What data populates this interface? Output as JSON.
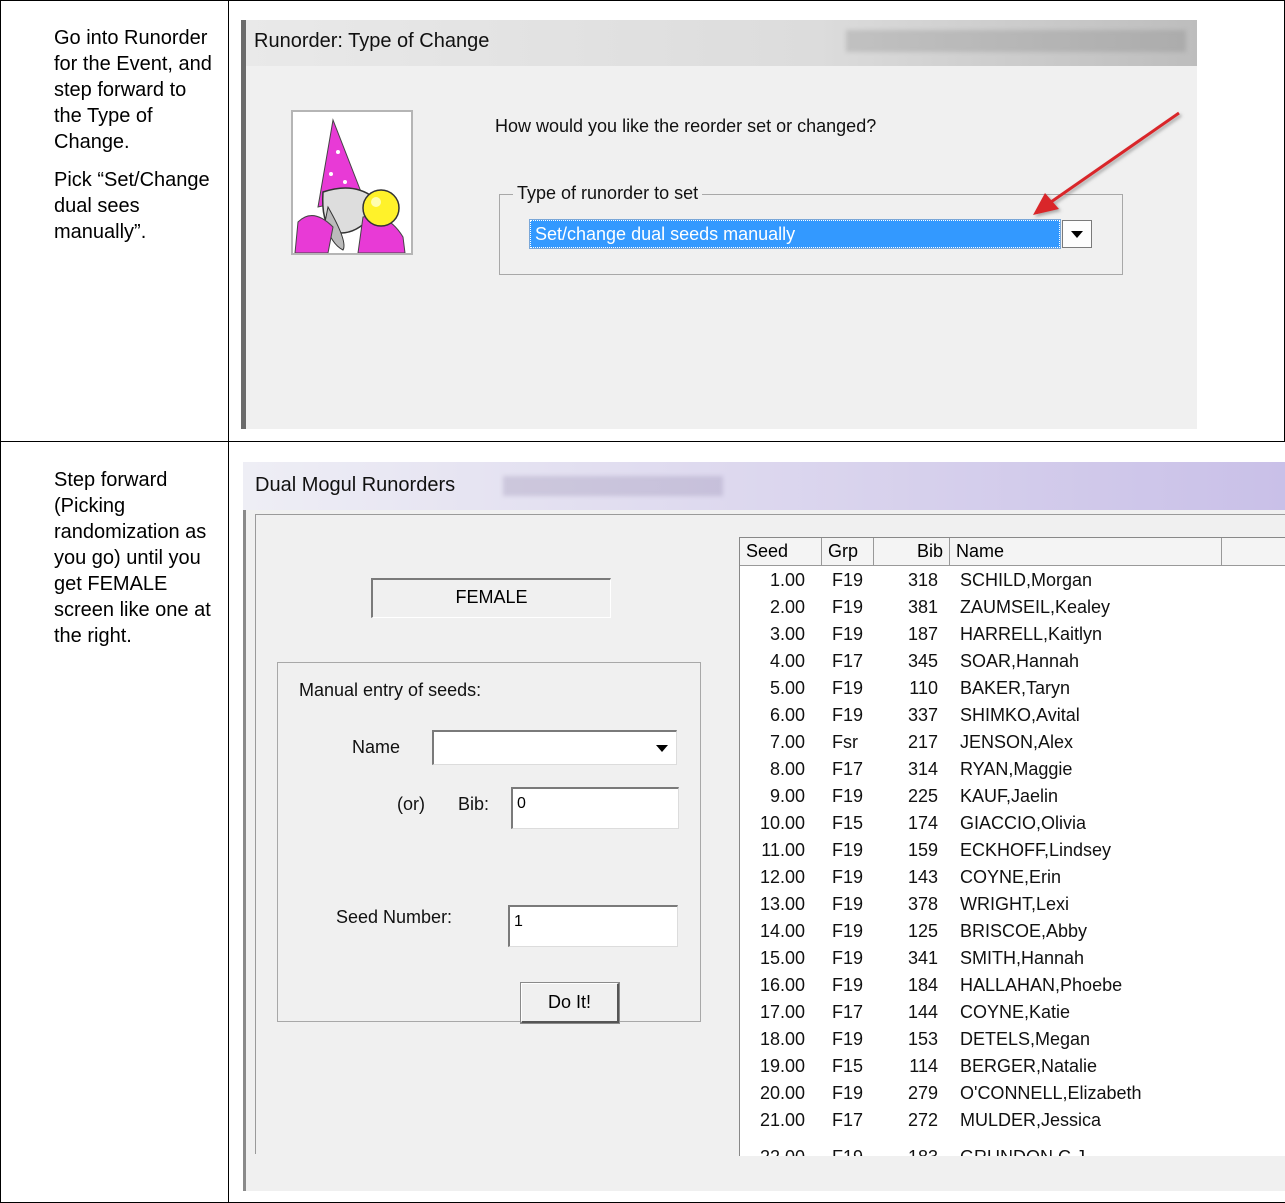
{
  "row1": {
    "instructions": [
      "Go into Runorder for the Event, and step forward to the Type of Change.",
      "Pick “Set/Change dual sees manually”."
    ],
    "screenshot": {
      "title": "Runorder: Type of Change",
      "question": "How would you like the reorder set or changed?",
      "group_label": "Type of runorder to set",
      "selected_option": "Set/change dual seeds manually",
      "annotation_arrow_color": "#d9262b"
    }
  },
  "row2": {
    "instructions": [
      "Step forward (Picking randomization as you go) until you get FEMALE screen like one at the right."
    ],
    "screenshot": {
      "title": "Dual Mogul Runorders",
      "gender_display": "FEMALE",
      "manual_group_label": "Manual entry of seeds:",
      "name_label": "Name",
      "name_value": "",
      "or_label": "(or)",
      "bib_label": "Bib:",
      "bib_value": "0",
      "seed_label": "Seed Number:",
      "seed_value": "1",
      "do_it_label": "Do It!",
      "columns": [
        "Seed",
        "Grp",
        "Bib",
        "Name"
      ],
      "rows": [
        {
          "seed": "1.00",
          "grp": "F19",
          "bib": "318",
          "name": "SCHILD,Morgan"
        },
        {
          "seed": "2.00",
          "grp": "F19",
          "bib": "381",
          "name": "ZAUMSEIL,Kealey"
        },
        {
          "seed": "3.00",
          "grp": "F19",
          "bib": "187",
          "name": "HARRELL,Kaitlyn"
        },
        {
          "seed": "4.00",
          "grp": "F17",
          "bib": "345",
          "name": "SOAR,Hannah"
        },
        {
          "seed": "5.00",
          "grp": "F19",
          "bib": "110",
          "name": "BAKER,Taryn"
        },
        {
          "seed": "6.00",
          "grp": "F19",
          "bib": "337",
          "name": "SHIMKO,Avital"
        },
        {
          "seed": "7.00",
          "grp": "Fsr",
          "bib": "217",
          "name": "JENSON,Alex"
        },
        {
          "seed": "8.00",
          "grp": "F17",
          "bib": "314",
          "name": "RYAN,Maggie"
        },
        {
          "seed": "9.00",
          "grp": "F19",
          "bib": "225",
          "name": "KAUF,Jaelin"
        },
        {
          "seed": "10.00",
          "grp": "F15",
          "bib": "174",
          "name": "GIACCIO,Olivia"
        },
        {
          "seed": "11.00",
          "grp": "F19",
          "bib": "159",
          "name": "ECKHOFF,Lindsey"
        },
        {
          "seed": "12.00",
          "grp": "F19",
          "bib": "143",
          "name": "COYNE,Erin"
        },
        {
          "seed": "13.00",
          "grp": "F19",
          "bib": "378",
          "name": "WRIGHT,Lexi"
        },
        {
          "seed": "14.00",
          "grp": "F19",
          "bib": "125",
          "name": "BRISCOE,Abby"
        },
        {
          "seed": "15.00",
          "grp": "F19",
          "bib": "341",
          "name": "SMITH,Hannah"
        },
        {
          "seed": "16.00",
          "grp": "F19",
          "bib": "184",
          "name": "HALLAHAN,Phoebe"
        },
        {
          "seed": "17.00",
          "grp": "F17",
          "bib": "144",
          "name": "COYNE,Katie"
        },
        {
          "seed": "18.00",
          "grp": "F19",
          "bib": "153",
          "name": "DETELS,Megan"
        },
        {
          "seed": "19.00",
          "grp": "F15",
          "bib": "114",
          "name": "BERGER,Natalie"
        },
        {
          "seed": "20.00",
          "grp": "F19",
          "bib": "279",
          "name": "O'CONNELL,Elizabeth"
        },
        {
          "seed": "21.00",
          "grp": "F17",
          "bib": "272",
          "name": "MULDER,Jessica"
        }
      ]
    }
  }
}
